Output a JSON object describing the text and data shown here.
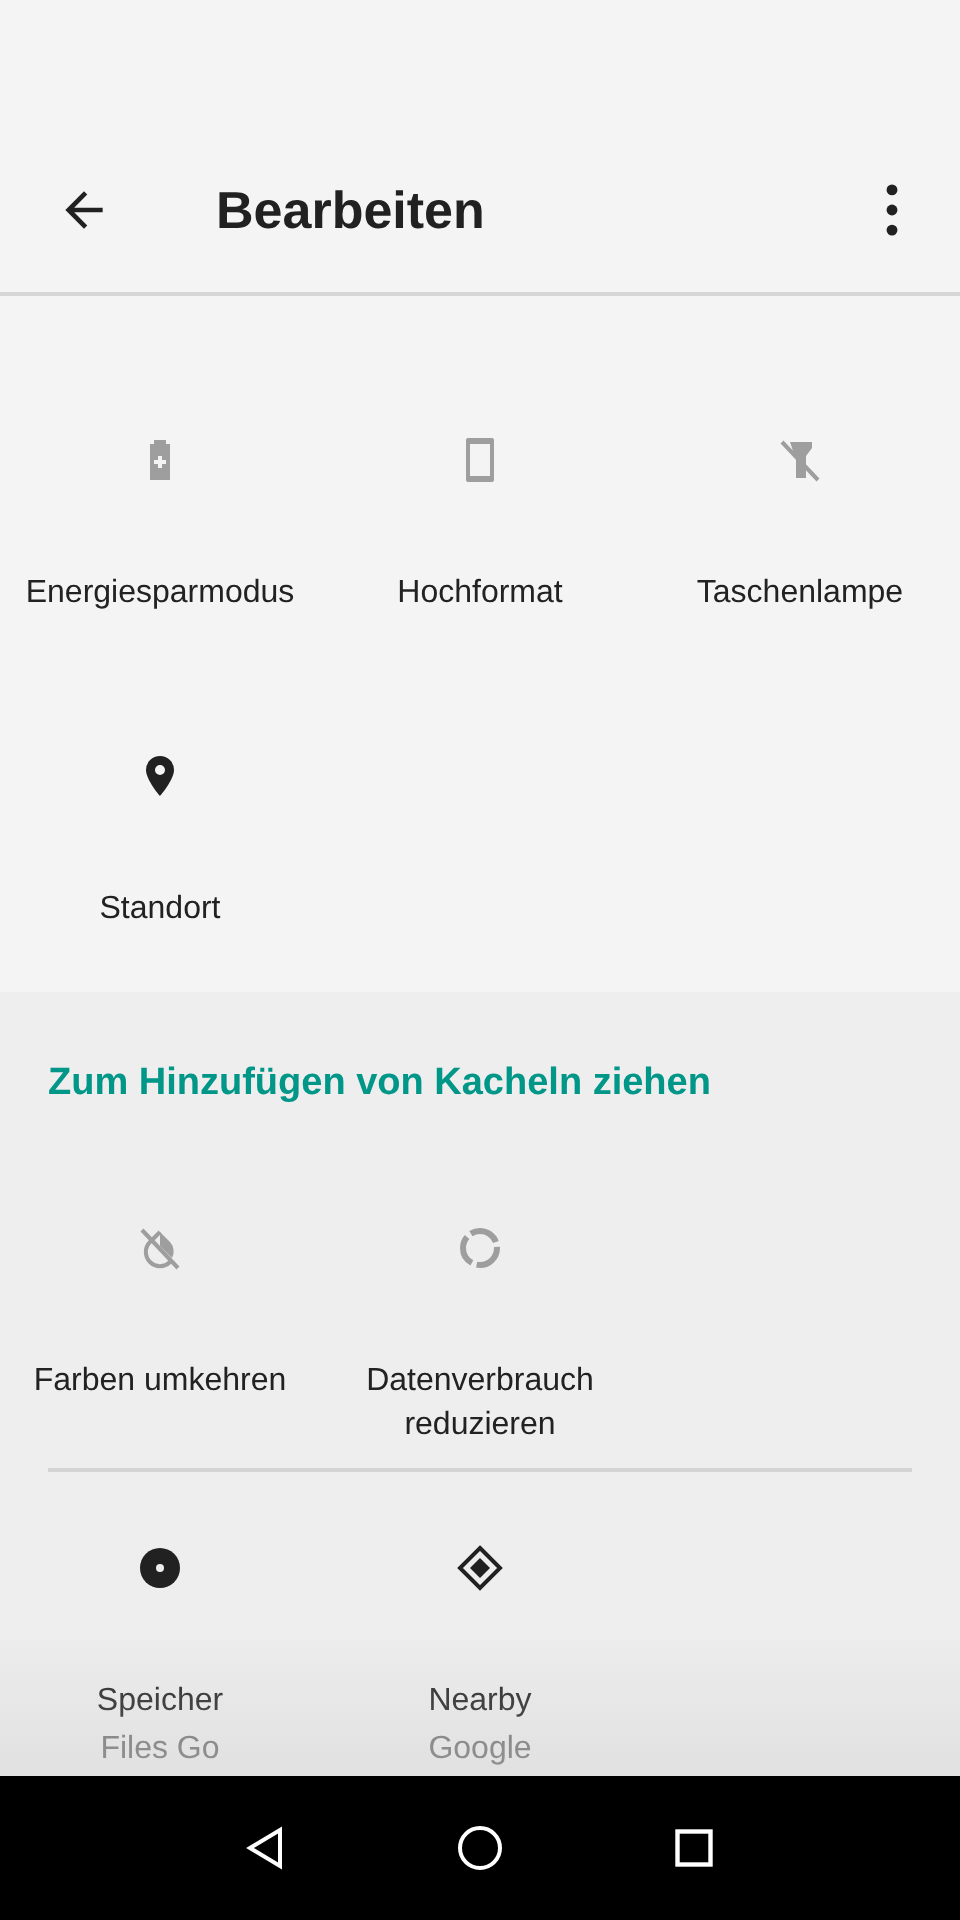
{
  "toolbar": {
    "title": "Bearbeiten"
  },
  "active_tiles": [
    {
      "label": "Energiesparmodus",
      "kind": "battery",
      "active": false
    },
    {
      "label": "Hochformat",
      "kind": "portrait",
      "active": false
    },
    {
      "label": "Taschenlampe",
      "kind": "flashlight",
      "active": false
    },
    {
      "label": "Standort",
      "kind": "location",
      "active": true
    }
  ],
  "available_header": "Zum Hinzufügen von Kacheln ziehen",
  "available_tiles": [
    {
      "label": "Farben umkehren",
      "kind": "invert",
      "active": false
    },
    {
      "label": "Datenverbrauch reduzieren",
      "kind": "datasaver",
      "active": false
    }
  ],
  "app_tiles": [
    {
      "label": "Speicher",
      "subtitle": "Files Go",
      "kind": "disc",
      "active": true
    },
    {
      "label": "Nearby",
      "subtitle": "Google",
      "kind": "diamond",
      "active": true
    }
  ]
}
